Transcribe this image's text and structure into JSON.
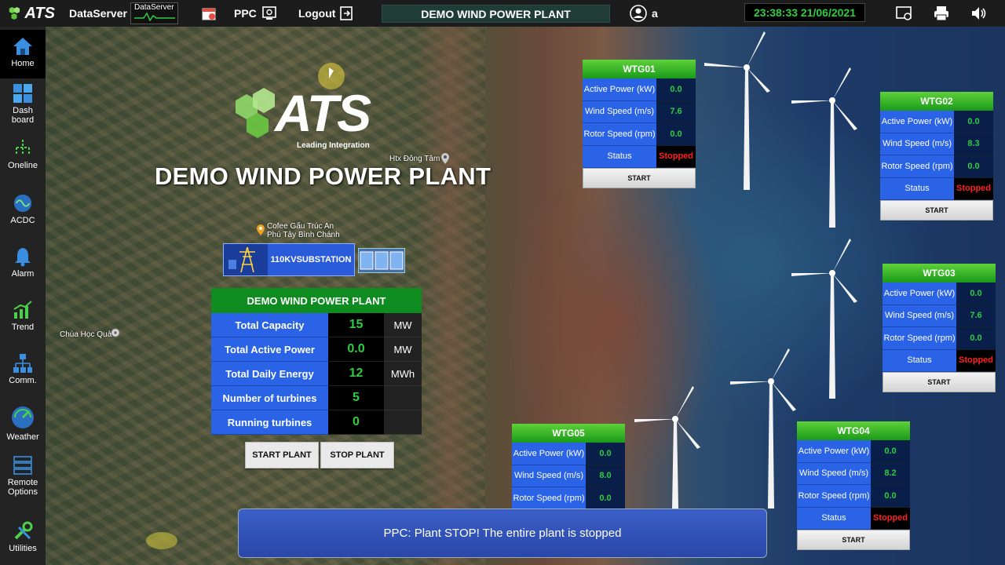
{
  "topbar": {
    "logo": "ATS",
    "dataserver_label": "DataServer",
    "dataserver_box": "DataServer",
    "ppc_label": "PPC",
    "logout_label": "Logout",
    "plant_title": "DEMO WIND POWER PLANT",
    "user": "a",
    "clock": "23:38:33 21/06/2021"
  },
  "sidebar": {
    "items": [
      {
        "label": "Home"
      },
      {
        "label": "Dash board"
      },
      {
        "label": "Oneline"
      },
      {
        "label": "ACDC"
      },
      {
        "label": "Alarm"
      },
      {
        "label": "Trend"
      },
      {
        "label": "Comm."
      },
      {
        "label": "Weather"
      },
      {
        "label": "Remote Options"
      },
      {
        "label": "Utilities"
      }
    ]
  },
  "map": {
    "title": "DEMO WIND POWER PLANT",
    "logo_word": "ATS",
    "logo_tagline": "Leading Integration",
    "labels": {
      "htx": "Htx Đông Tâm",
      "cafe_line1": "Cofee Gấu Trúc An",
      "cafe_line2": "Phú Tây Bình Chánh",
      "chua": "Chùa Học Quả"
    },
    "substation_line1": "110KV",
    "substation_line2": "SUBSTATION"
  },
  "plant": {
    "header": "DEMO WIND POWER PLANT",
    "rows": [
      {
        "label": "Total Capacity",
        "value": "15",
        "unit": "MW"
      },
      {
        "label": "Total Active Power",
        "value": "0.0",
        "unit": "MW"
      },
      {
        "label": "Total Daily Energy",
        "value": "12",
        "unit": "MWh"
      },
      {
        "label": "Number of turbines",
        "value": "5",
        "unit": ""
      },
      {
        "label": "Running turbines",
        "value": "0",
        "unit": ""
      }
    ],
    "start_btn": "START PLANT",
    "stop_btn": "STOP PLANT"
  },
  "wtg_labels": {
    "active_power": "Active Power (kW)",
    "wind_speed": "Wind Speed (m/s)",
    "rotor_speed": "Rotor Speed (rpm)",
    "status": "Status",
    "start": "START"
  },
  "wtgs": [
    {
      "name": "WTG01",
      "active_power": "0.0",
      "wind_speed": "7.6",
      "rotor_speed": "0.0",
      "status": "Stopped"
    },
    {
      "name": "WTG02",
      "active_power": "0.0",
      "wind_speed": "8.3",
      "rotor_speed": "0.0",
      "status": "Stopped"
    },
    {
      "name": "WTG03",
      "active_power": "0.0",
      "wind_speed": "7.6",
      "rotor_speed": "0.0",
      "status": "Stopped"
    },
    {
      "name": "WTG04",
      "active_power": "0.0",
      "wind_speed": "8.2",
      "rotor_speed": "0.0",
      "status": "Stopped"
    },
    {
      "name": "WTG05",
      "active_power": "0.0",
      "wind_speed": "8.0",
      "rotor_speed": "0.0"
    }
  ],
  "message": "PPC: Plant STOP! The entire plant is stopped",
  "colors": {
    "accent_green": "#2ecc40",
    "label_blue": "#2b63e6",
    "status_red": "#ff2020"
  }
}
